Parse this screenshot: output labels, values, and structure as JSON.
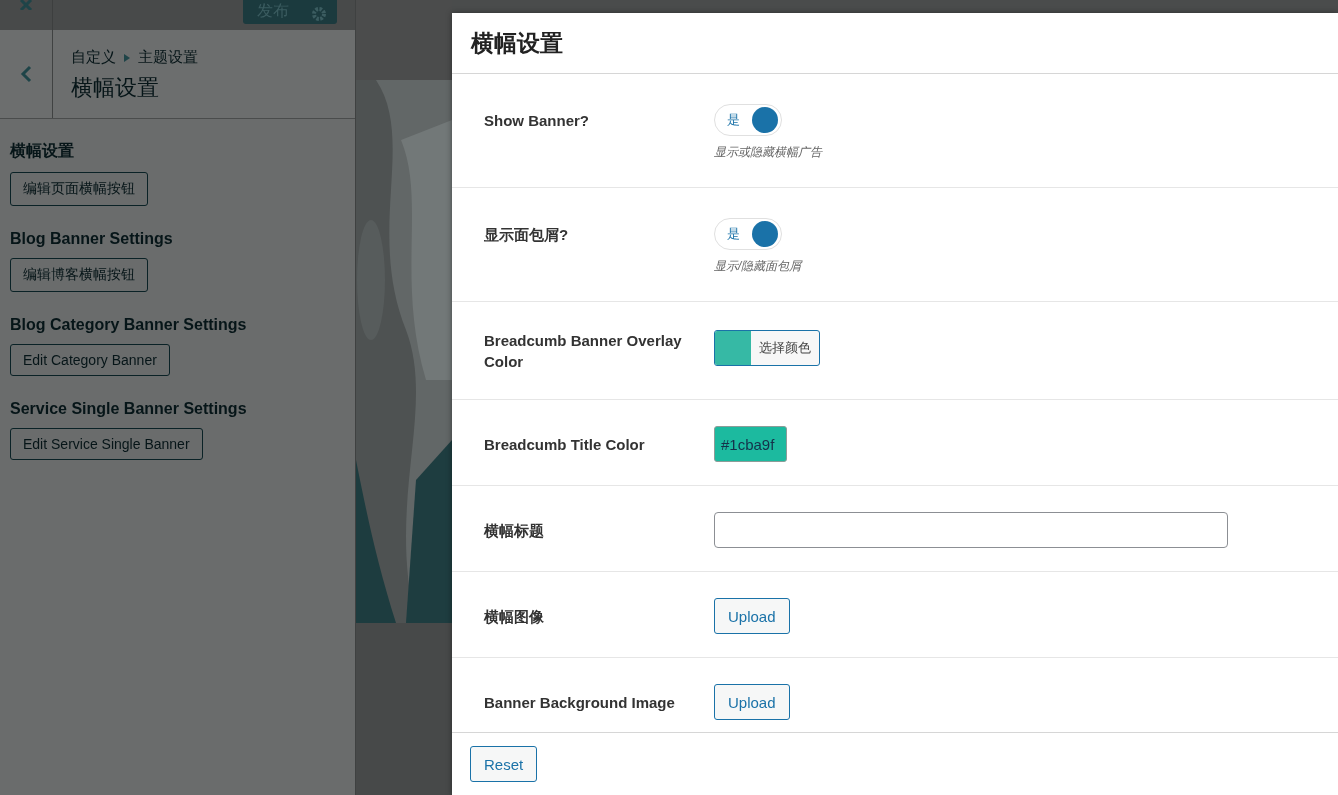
{
  "sidebar": {
    "publish_button": "发布",
    "breadcrumb": [
      "自定义",
      "主题设置"
    ],
    "title": "横幅设置",
    "sections": [
      {
        "heading": "横幅设置",
        "button": "编辑页面横幅按钮"
      },
      {
        "heading": "Blog Banner Settings",
        "button": "编辑博客横幅按钮"
      },
      {
        "heading": "Blog Category Banner Settings",
        "button": "Edit Category Banner"
      },
      {
        "heading": "Service Single Banner Settings",
        "button": "Edit Service Single Banner"
      }
    ]
  },
  "modal": {
    "title": "横幅设置",
    "rows": [
      {
        "kind": "toggle",
        "label": "Show Banner?",
        "on": true,
        "toggle_label": "是",
        "description": "显示或隐藏横幅广告"
      },
      {
        "kind": "toggle",
        "label": "显示面包屑?",
        "on": true,
        "toggle_label": "是",
        "description": "显示/隐藏面包屑"
      },
      {
        "kind": "color_picker",
        "label": "Breadcumb Banner Overlay Color",
        "button": "选择颜色",
        "color": "#36b9a5"
      },
      {
        "kind": "color_value",
        "label": "Breadcumb Title Color",
        "value": "#1cba9f"
      },
      {
        "kind": "text",
        "label": "横幅标题"
      },
      {
        "kind": "upload",
        "label": "横幅图像",
        "button": "Upload"
      },
      {
        "kind": "upload",
        "label": "Banner Background Image",
        "button": "Upload"
      }
    ],
    "reset_button": "Reset"
  }
}
